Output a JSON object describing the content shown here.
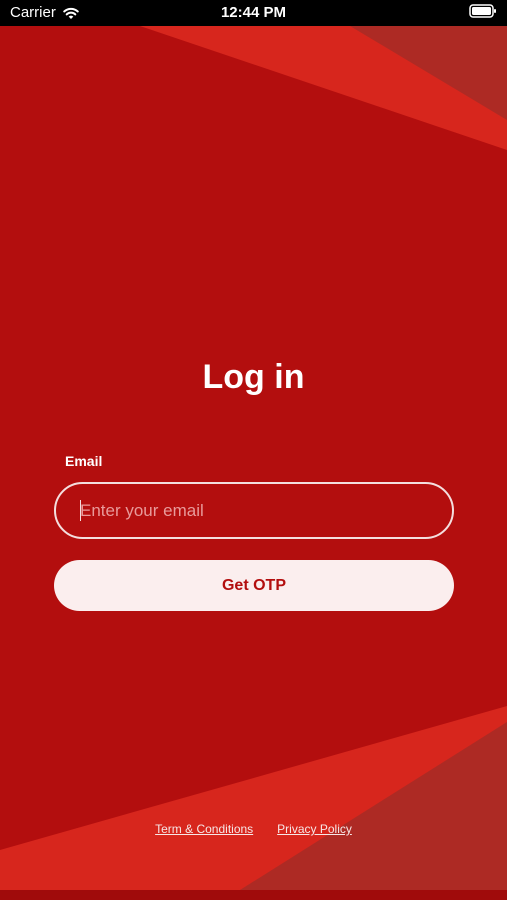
{
  "status_bar": {
    "carrier": "Carrier",
    "time": "12:44 PM"
  },
  "login": {
    "title": "Log in",
    "email_label": "Email",
    "email_placeholder": "Enter your email",
    "email_value": "",
    "submit_label": "Get OTP"
  },
  "footer": {
    "terms_label": "Term & Conditions",
    "privacy_label": "Privacy Policy"
  },
  "colors": {
    "background": "#b30e0e",
    "accent_shape": "#d7261d",
    "muted_shape": "#ad2a24",
    "button_bg": "#fbeeee",
    "button_text": "#b30e0e"
  },
  "icons": {
    "wifi": "wifi-icon",
    "battery": "battery-icon"
  }
}
